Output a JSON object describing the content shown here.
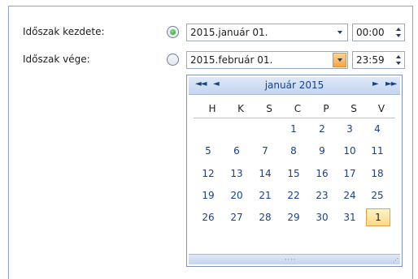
{
  "form": {
    "start_label": "Időszak kezdete:",
    "end_label": "Időszak vége:",
    "start_date": "2015.január 01.",
    "start_time": "00:00",
    "end_date": "2015.február 01.",
    "end_time": "23:59",
    "selected_option": "start"
  },
  "calendar": {
    "month_title": "január 2015",
    "nav_prev_year": "◄◄",
    "nav_prev_month": "◄",
    "nav_next_month": "►",
    "nav_next_year": "►►",
    "weekdays": [
      "H",
      "K",
      "S",
      "C",
      "P",
      "S",
      "V"
    ],
    "weeks": [
      [
        "",
        "",
        "",
        "1",
        "2",
        "3",
        "4"
      ],
      [
        "5",
        "6",
        "7",
        "8",
        "9",
        "10",
        "11"
      ],
      [
        "12",
        "13",
        "14",
        "15",
        "16",
        "17",
        "18"
      ],
      [
        "19",
        "20",
        "21",
        "22",
        "23",
        "24",
        "25"
      ],
      [
        "26",
        "27",
        "28",
        "29",
        "30",
        "31",
        "1"
      ]
    ],
    "selected_day": "1",
    "footer_grip": "····",
    "colors": {
      "accent": "#15428b",
      "selected_bg": "#ffd98a",
      "selected_border": "#e8a23c",
      "header_bg": "#c4d5ee"
    }
  }
}
